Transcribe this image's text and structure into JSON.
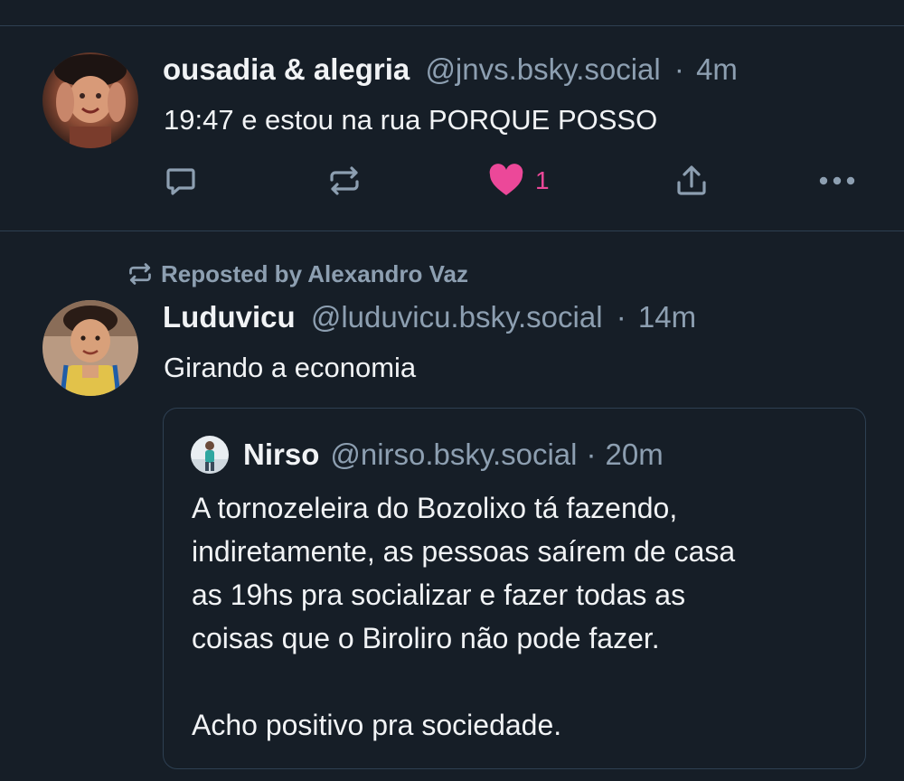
{
  "post1": {
    "author_name": "ousadia & alegria",
    "handle": "@jnvs.bsky.social",
    "separator": "·",
    "time": "4m",
    "text": "19:47 e estou na rua PORQUE POSSO",
    "like_count": "1",
    "liked": true,
    "icons": [
      "reply-icon",
      "repost-icon",
      "heart-icon",
      "share-icon",
      "more-icon"
    ]
  },
  "post2": {
    "reposted_by": "Reposted by Alexandro Vaz",
    "author_name": "Luduvicu",
    "handle": "@luduvicu.bsky.social",
    "separator": "·",
    "time": "14m",
    "text": "Girando a economia",
    "quote": {
      "author_name": "Nirso",
      "handle": "@nirso.bsky.social",
      "separator": "·",
      "time": "20m",
      "lines": [
        "A tornozeleira do Bozolixo tá fazendo,",
        "indiretamente, as pessoas saírem de casa",
        "as 19hs pra socializar e fazer todas as",
        "coisas que o Biroliro não pode fazer."
      ],
      "last_line": "Acho positivo pra sociedade."
    }
  },
  "colors": {
    "background": "#161e27",
    "divider": "#2e4052",
    "muted_text": "#8d9fb1",
    "primary_text": "#f1f3f5",
    "like_accent": "#ec4899"
  }
}
